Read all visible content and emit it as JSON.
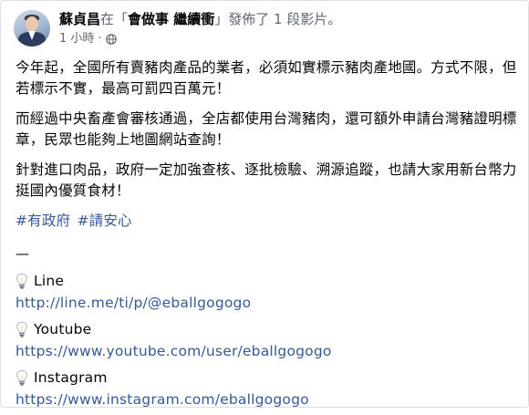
{
  "post": {
    "author": "蘇貞昌",
    "connector_in": "在「",
    "page_name": "會做事 繼續衝",
    "connector_action": "」發佈了 1 段影片。",
    "time": "1 小時",
    "time_separator": "·"
  },
  "body": {
    "paragraphs": [
      "今年起，全國所有賣豬肉產品的業者，必須如實標示豬肉產地國。方式不限，但若標示不實，最高可罰四百萬元！",
      "而經過中央畜產會審核通過，全店都使用台灣豬肉，還可額外申請台灣豬證明標章，民眾也能夠上地圖網站查詢！",
      "針對進口肉品，政府一定加強查核、逐批檢驗、溯源追蹤，也請大家用新台幣力挺國內優質食材！"
    ],
    "hashtags": [
      "#有政府",
      "#請安心"
    ],
    "divider": "—"
  },
  "links": [
    {
      "title": "Line",
      "url": "http://line.me/ti/p/@eballgogogo"
    },
    {
      "title": "Youtube",
      "url": "https://www.youtube.com/user/eballgogogo"
    },
    {
      "title": "Instagram",
      "url": "https://www.instagram.com/eballgogogo"
    }
  ],
  "colors": {
    "link": "#385898",
    "meta_text": "#65676b",
    "text": "#050505"
  },
  "icons": {
    "globe": "globe-icon",
    "bulb": "light-bulb-icon"
  }
}
